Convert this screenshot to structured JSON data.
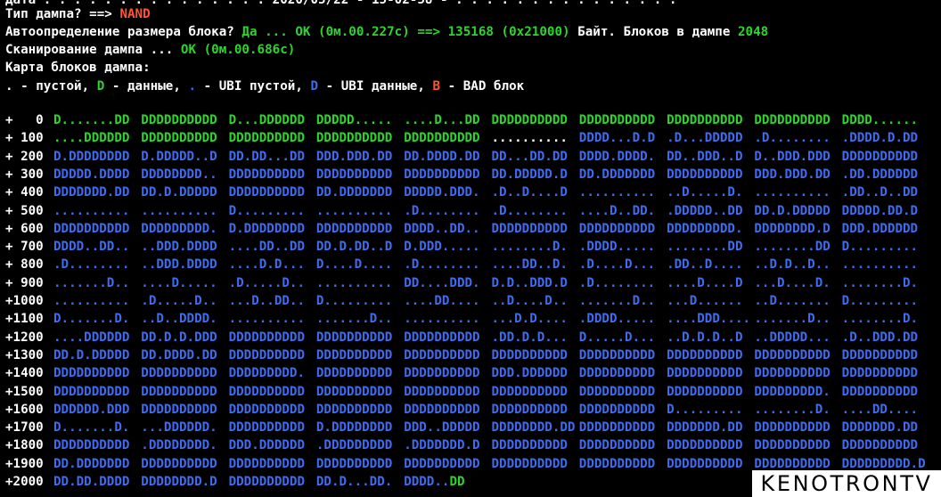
{
  "header": {
    "cut_line": "Дата : . . . . . . . . . . . . . . 2020/05/22 - 15-02-58 - . . . . . . . . . . . . . . .",
    "dump_type_label": "Тип дампа? ==> ",
    "dump_type_value": "NAND",
    "auto_label": "Автоопределение размера блока? ",
    "auto_yes": "Да ... OK (0м.00.227с) ==> ",
    "auto_size": "135168 (0x21000)",
    "auto_bytes": " Байт. Блоков в дампе ",
    "auto_blocks": "2048",
    "scan_label": "Сканирование дампа ... ",
    "scan_value": "OK (0м.00.686с)",
    "map_title": "Карта блоков дампа:",
    "legend": {
      "empty": ". - пустой, ",
      "data_sym": "D",
      "data_txt": " - данные, ",
      "ubi_empty_sym": ".",
      "ubi_empty_txt": " - UBI пустой, ",
      "ubi_data_sym": "D",
      "ubi_data_txt": " - UBI данные, ",
      "bad_sym": "B",
      "bad_txt": " - BAD блок"
    }
  },
  "colors": {
    "background": "#000000",
    "text": "#ffffff",
    "data": "#2dd52d",
    "ubi": "#3f6cf0",
    "bad": "#ff5533"
  },
  "map": [
    {
      "idx": "+   0",
      "blocks": [
        [
          "y",
          "D.......DD"
        ],
        [
          "y",
          "DDDDDDDDDD"
        ],
        [
          "y",
          "D...DDDDDD"
        ],
        [
          "y",
          "DDDDD....."
        ],
        [
          "y",
          "....D...DD"
        ],
        [
          "y",
          "DDDDDDDDDD"
        ],
        [
          "y",
          "DDDDDDDDDD"
        ],
        [
          "y",
          "DDDDDDDDDD"
        ],
        [
          "y",
          "DDDDDDDDDD"
        ],
        [
          "y",
          "DDDD......"
        ]
      ]
    },
    {
      "idx": "+ 100",
      "blocks": [
        [
          "y",
          "....DDDDDD"
        ],
        [
          "y",
          "DDDDDDDDDD"
        ],
        [
          "y",
          "DDDDDDDDDD"
        ],
        [
          "y",
          "DDDDDDDDDD"
        ],
        [
          "y",
          "DDDDDDDDDD"
        ],
        [
          "w",
          ".........."
        ],
        [
          "b",
          "DDDD...D.D"
        ],
        [
          "b",
          ".D...DDDDD"
        ],
        [
          "b",
          ".D........"
        ],
        [
          "b",
          ".DDDD.D.DD"
        ]
      ]
    },
    {
      "idx": "+ 200",
      "blocks": [
        [
          "b",
          "D.DDDDDDDD"
        ],
        [
          "b",
          "D.DDDDD..D"
        ],
        [
          "b",
          "DD.DD...DD"
        ],
        [
          "b",
          "DDD.DDD.DD"
        ],
        [
          "b",
          "DD.DDDD.DD"
        ],
        [
          "b",
          "DD...DD.DD"
        ],
        [
          "b",
          "DDDD.DDDD."
        ],
        [
          "b",
          "DD..DDD..D"
        ],
        [
          "b",
          "D..DDD.DDD"
        ],
        [
          "b",
          "DDDDDDDDDD"
        ]
      ]
    },
    {
      "idx": "+ 300",
      "blocks": [
        [
          "b",
          "DDDDD.DDDD"
        ],
        [
          "b",
          "DDDDDDDD.."
        ],
        [
          "b",
          "DDDDDDDDDD"
        ],
        [
          "b",
          "DDDDDDDDDD"
        ],
        [
          "b",
          "DDDDDDDDDD"
        ],
        [
          "b",
          "DD.DDDDD.D"
        ],
        [
          "b",
          "DD.DDDDDDD"
        ],
        [
          "b",
          "DDDDDDDDDD"
        ],
        [
          "b",
          "DDD.DDD.DD"
        ],
        [
          "b",
          ".DD.DDDDDD"
        ]
      ]
    },
    {
      "idx": "+ 400",
      "blocks": [
        [
          "b",
          "DDDDDDD.DD"
        ],
        [
          "b",
          "DD.D.DDDDD"
        ],
        [
          "b",
          "DDDDDDDDDD"
        ],
        [
          "b",
          "DD.DDDDDDD"
        ],
        [
          "b",
          "DDDDD.DDD."
        ],
        [
          "b",
          ".D..D....D"
        ],
        [
          "b",
          ".........."
        ],
        [
          "b",
          "..D.....D."
        ],
        [
          "b",
          ".........."
        ],
        [
          "b",
          ".DD..D..DD"
        ]
      ]
    },
    {
      "idx": "+ 500",
      "blocks": [
        [
          "b",
          ".........."
        ],
        [
          "b",
          ".........."
        ],
        [
          "b",
          "D........."
        ],
        [
          "b",
          ".........."
        ],
        [
          "b",
          ".D........"
        ],
        [
          "b",
          ".D........"
        ],
        [
          "b",
          "....D..DD."
        ],
        [
          "b",
          ".DDDDD..DD"
        ],
        [
          "b",
          "DD.D.DDDDD"
        ],
        [
          "b",
          "DDDDD.DD.D"
        ]
      ]
    },
    {
      "idx": "+ 600",
      "blocks": [
        [
          "b",
          "DDDDDDDDDD"
        ],
        [
          "b",
          "DDDDDDDDD."
        ],
        [
          "b",
          "D.DDDDDDDD"
        ],
        [
          "b",
          "DDDDDDDDDD"
        ],
        [
          "b",
          "DDDD..DD.."
        ],
        [
          "b",
          "DDDDDDDDDD"
        ],
        [
          "b",
          "DDDDDDDDDD"
        ],
        [
          "b",
          "DDDDDDDDD."
        ],
        [
          "b",
          "DDDDDDDD.D"
        ],
        [
          "b",
          "DDD.DDDDDD"
        ]
      ]
    },
    {
      "idx": "+ 700",
      "blocks": [
        [
          "b",
          "DDDD..DD.."
        ],
        [
          "b",
          "..DDD.DDDD"
        ],
        [
          "b",
          "....DD..DD"
        ],
        [
          "b",
          "DD.D.DD..D"
        ],
        [
          "b",
          "D.DDD....."
        ],
        [
          "b",
          "........D."
        ],
        [
          "b",
          ".DDDD....."
        ],
        [
          "b",
          "........DD"
        ],
        [
          "b",
          "........DD"
        ],
        [
          "b",
          "D........."
        ]
      ]
    },
    {
      "idx": "+ 800",
      "blocks": [
        [
          "b",
          ".D........"
        ],
        [
          "b",
          "..DDD.DDDD"
        ],
        [
          "b",
          "....D.D..."
        ],
        [
          "b",
          "D....D...."
        ],
        [
          "b",
          ".D........"
        ],
        [
          "b",
          "....DD..D."
        ],
        [
          "b",
          ".D....D..."
        ],
        [
          "b",
          ".DD..D...."
        ],
        [
          "b",
          "..D.D..D.."
        ],
        [
          "b",
          ".........."
        ]
      ]
    },
    {
      "idx": "+ 900",
      "blocks": [
        [
          "b",
          ".......D.."
        ],
        [
          "b",
          "....D....."
        ],
        [
          "b",
          ".D.....D.."
        ],
        [
          "b",
          ".........."
        ],
        [
          "b",
          "DD....DDD."
        ],
        [
          "b",
          "D.D..DDD.D"
        ],
        [
          "b",
          ".D........"
        ],
        [
          "b",
          "....D....D"
        ],
        [
          "b",
          "...D....D."
        ],
        [
          "b",
          "........D."
        ]
      ]
    },
    {
      "idx": "+1000",
      "blocks": [
        [
          "b",
          ".........."
        ],
        [
          "b",
          ".D.....D.."
        ],
        [
          "b",
          "...D..DD.."
        ],
        [
          "b",
          "D........."
        ],
        [
          "b",
          "....DD...."
        ],
        [
          "b",
          "..D....D.."
        ],
        [
          "b",
          ".......D.."
        ],
        [
          "b",
          "...D......"
        ],
        [
          "b",
          "..D......."
        ],
        [
          "b",
          "D........."
        ]
      ]
    },
    {
      "idx": "+1100",
      "blocks": [
        [
          "b",
          "D.......D."
        ],
        [
          "b",
          "..D..DDDD."
        ],
        [
          "b",
          ".........."
        ],
        [
          "b",
          ".......D.."
        ],
        [
          "b",
          ".........."
        ],
        [
          "b",
          "...D.D...."
        ],
        [
          "b",
          ".DDDD....."
        ],
        [
          "b",
          "....DDD...."
        ],
        [
          "b",
          ".......D.."
        ],
        [
          "b",
          "........D."
        ]
      ]
    },
    {
      "idx": "+1200",
      "blocks": [
        [
          "b",
          "....DDDDDD"
        ],
        [
          "b",
          "DD.D.D.DDD"
        ],
        [
          "b",
          "DDDDDDDDDD"
        ],
        [
          "b",
          "DDDDDDDDDD"
        ],
        [
          "b",
          "DDDDDDDDDD"
        ],
        [
          "b",
          ".DD.D.D..."
        ],
        [
          "b",
          "D.....D..."
        ],
        [
          "b",
          "..D.D.D..D"
        ],
        [
          "b",
          "..DDDDD..."
        ],
        [
          "b",
          ".D..DDD.DD"
        ]
      ]
    },
    {
      "idx": "+1300",
      "blocks": [
        [
          "b",
          "DD.D.DDDDD"
        ],
        [
          "b",
          "DD.DDDD.DD"
        ],
        [
          "b",
          "DDDDDDDDDD"
        ],
        [
          "b",
          "DDDDDDDDDD"
        ],
        [
          "b",
          "DDDDDDDDDD"
        ],
        [
          "b",
          "DDDDDDDDDD"
        ],
        [
          "b",
          "DDDDDDDDDD"
        ],
        [
          "b",
          "DDDDDDDDDD"
        ],
        [
          "b",
          "DDDDDDDDDD"
        ],
        [
          "b",
          "DDDDDDDDDD"
        ]
      ]
    },
    {
      "idx": "+1400",
      "blocks": [
        [
          "b",
          "DDDDDDDDDD"
        ],
        [
          "b",
          "DDDDDDDDDD"
        ],
        [
          "b",
          "DDDDDDDDD."
        ],
        [
          "b",
          "DDDDDDDDDD"
        ],
        [
          "b",
          "DDDDDDDDDD"
        ],
        [
          "b",
          "DDD.DDDDDD"
        ],
        [
          "b",
          "DDDDDDDDDD"
        ],
        [
          "b",
          "DDDDDDDDDD"
        ],
        [
          "b",
          "DDDDDDDDDD"
        ],
        [
          "b",
          "DDDDDDDDDD"
        ]
      ]
    },
    {
      "idx": "+1500",
      "blocks": [
        [
          "b",
          "DDDDDDDDDD"
        ],
        [
          "b",
          "DDDDDDDDDD"
        ],
        [
          "b",
          "DDDDDDDDDD"
        ],
        [
          "b",
          "DDDDDDDDDD"
        ],
        [
          "b",
          "DDDDDDDDDD"
        ],
        [
          "b",
          "DDDDDDDDDD"
        ],
        [
          "b",
          "DDDDDDDDDD"
        ],
        [
          "b",
          "DDDDDDDDDD"
        ],
        [
          "b",
          "DDDDDDDDD."
        ],
        [
          "b",
          "DDDDDDDDDD"
        ]
      ]
    },
    {
      "idx": "+1600",
      "blocks": [
        [
          "b",
          "DDDDDD.DDD"
        ],
        [
          "b",
          "DDDDDDDDDD"
        ],
        [
          "b",
          "DDDDDDDDDD"
        ],
        [
          "b",
          "DDDDDDDDDD"
        ],
        [
          "b",
          "DDDDDDDDDD"
        ],
        [
          "b",
          "DDDDDDDDDD"
        ],
        [
          "b",
          "DDDDDDDDDD"
        ],
        [
          "b",
          "D........."
        ],
        [
          "b",
          "........D."
        ],
        [
          "b",
          "....DD...."
        ]
      ]
    },
    {
      "idx": "+1700",
      "blocks": [
        [
          "b",
          "D.......D."
        ],
        [
          "b",
          "...DDDDDD."
        ],
        [
          "b",
          "DDDDDDDDDD"
        ],
        [
          "b",
          "D.DDDDDDDD"
        ],
        [
          "b",
          "DDD..DDDDD"
        ],
        [
          "b",
          "DDDDDDDD.DD"
        ],
        [
          "b",
          "DDDDDDDDDD"
        ],
        [
          "b",
          "DDDDDDD.DD"
        ],
        [
          "b",
          "DDDDDDDDDD"
        ],
        [
          "b",
          "DDDDDDD.DD"
        ]
      ]
    },
    {
      "idx": "+1800",
      "blocks": [
        [
          "b",
          "DDDDDDDDDD"
        ],
        [
          "b",
          ".DDDDDDDD."
        ],
        [
          "b",
          "DDD.DDDDDD"
        ],
        [
          "b",
          ".DDDDDDDDD"
        ],
        [
          "b",
          ".DDDDDDD.D"
        ],
        [
          "b",
          "DDDDDDDDDD"
        ],
        [
          "b",
          "DDDDDDDDDD"
        ],
        [
          "b",
          "DDDDDDDDDD"
        ],
        [
          "b",
          "DDDDDDDDDD"
        ],
        [
          "b",
          "DDDDDDDDDD"
        ]
      ]
    },
    {
      "idx": "+1900",
      "blocks": [
        [
          "b",
          "DD.DDDDDDD"
        ],
        [
          "b",
          "DDDDDDDDDD"
        ],
        [
          "b",
          "DDDDDDDDDD"
        ],
        [
          "b",
          "DDDDDDDDDD"
        ],
        [
          "b",
          "DDDDDDDDDD"
        ],
        [
          "b",
          "DDDDDDDDDD"
        ],
        [
          "b",
          "DDDDDDDDDD"
        ],
        [
          "b",
          "DDDDDDDDDD"
        ],
        [
          "b",
          "DDDDDDDDDD"
        ],
        [
          "b",
          "DDDDDDDDD.D"
        ]
      ]
    },
    {
      "idx": "+2000",
      "blocks": [
        [
          "b",
          "DD.DD.DDDD"
        ],
        [
          "b",
          "DDDDDDDD.D"
        ],
        [
          "b",
          "DDDDDDDDDD"
        ],
        [
          "b",
          "DD.D...DD."
        ],
        [
          "mixed",
          ""
        ]
      ],
      "tail": [
        [
          "b",
          "DDDD.."
        ],
        [
          "y",
          "DD"
        ]
      ]
    }
  ],
  "watermark": "KENOTRONTV"
}
